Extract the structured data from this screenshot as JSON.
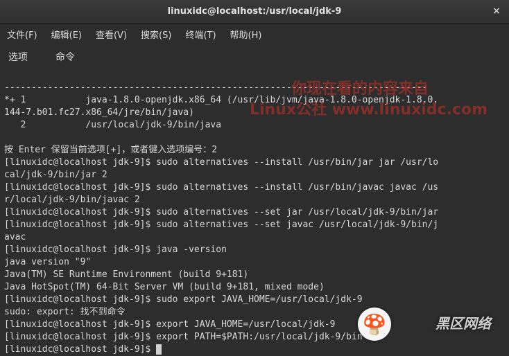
{
  "window": {
    "title": "linuxidc@localhost:/usr/local/jdk-9",
    "close_glyph": "×"
  },
  "menubar": {
    "file": "文件(F)",
    "edit": "编辑(E)",
    "view": "查看(V)",
    "search": "搜索(S)",
    "terminal": "终端(T)",
    "help": "帮助(H)"
  },
  "tabs": {
    "options": "选项",
    "command": "命令"
  },
  "terminal": {
    "lines": [
      "------------------------------------------------------------------------------",
      "*+ 1           java-1.8.0-openjdk.x86_64 (/usr/lib/jvm/java-1.8.0-openjdk-1.8.0.",
      "144-7.b01.fc27.x86_64/jre/bin/java)",
      "   2           /usr/local/jdk-9/bin/java",
      "",
      "按 Enter 保留当前选项[+]，或者键入选项编号：2",
      "[linuxidc@localhost jdk-9]$ sudo alternatives --install /usr/bin/jar jar /usr/lo",
      "cal/jdk-9/bin/jar 2",
      "[linuxidc@localhost jdk-9]$ sudo alternatives --install /usr/bin/javac javac /us",
      "r/local/jdk-9/bin/javac 2",
      "[linuxidc@localhost jdk-9]$ sudo alternatives --set jar /usr/local/jdk-9/bin/jar",
      "[linuxidc@localhost jdk-9]$ sudo alternatives --set javac /usr/local/jdk-9/bin/j",
      "avac",
      "[linuxidc@localhost jdk-9]$ java -version",
      "java version \"9\"",
      "Java(TM) SE Runtime Environment (build 9+181)",
      "Java HotSpot(TM) 64-Bit Server VM (build 9+181, mixed mode)",
      "[linuxidc@localhost jdk-9]$ sudo export JAVA_HOME=/usr/local/jdk-9",
      "sudo: export: 找不到命令",
      "[linuxidc@localhost jdk-9]$ export JAVA_HOME=/usr/local/jdk-9",
      "[linuxidc@localhost jdk-9]$ export PATH=$PATH:/usr/local/jdk-9/bin"
    ],
    "prompt": "[linuxidc@localhost jdk-9]$ "
  },
  "watermark": {
    "line1": "你现在看的内容来自",
    "line2": "Linux公社 www.linuxidc.com",
    "logo_glyph": "🍄",
    "logo_text": "黑区网络"
  }
}
